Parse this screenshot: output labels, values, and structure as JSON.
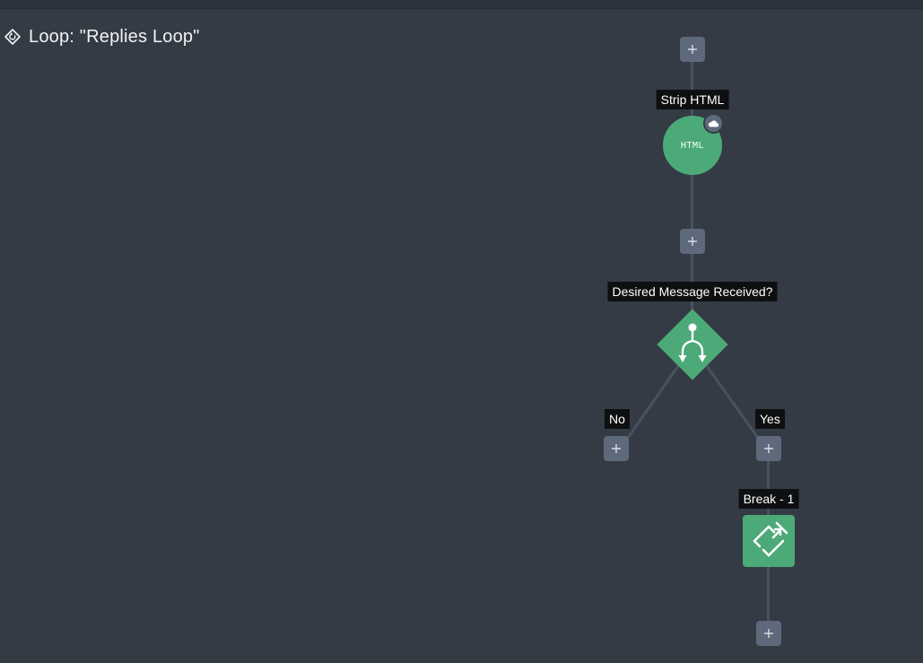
{
  "loop": {
    "title": "Loop: \"Replies Loop\"",
    "icon": "loop-tag-icon"
  },
  "nodes": {
    "strip_html": {
      "label": "Strip HTML",
      "icon_text": "HTML",
      "badge_icon": "cloud-icon"
    },
    "condition": {
      "label": "Desired Message Received?",
      "icon": "branch-icon",
      "branch_no": "No",
      "branch_yes": "Yes"
    },
    "break": {
      "label": "Break - 1",
      "icon": "loop-break-icon"
    }
  },
  "add_button_icon": "plus-icon",
  "colors": {
    "background": "#343b45",
    "node_green": "#4caa78",
    "add_button": "#5e6a7b",
    "connector": "#485260",
    "label_bg": "#0e0f11"
  }
}
